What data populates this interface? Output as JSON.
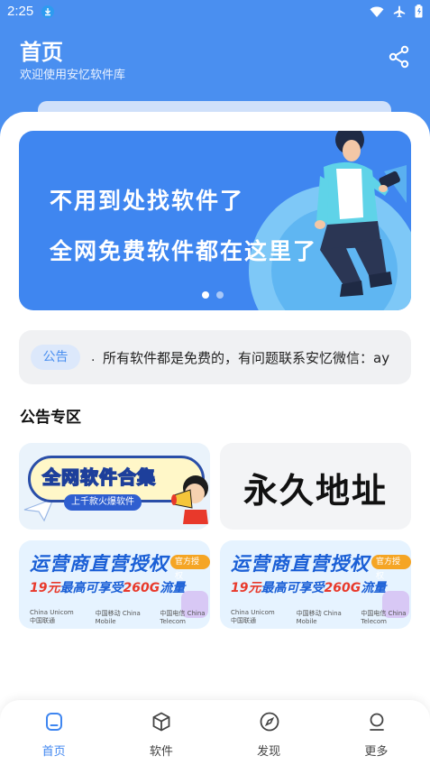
{
  "status_bar": {
    "time": "2:25",
    "icons": [
      "download-icon",
      "wifi-icon",
      "airplane-icon",
      "battery-icon"
    ]
  },
  "header": {
    "title": "首页",
    "subtitle": "欢迎使用安忆软件库",
    "share_icon": "share-icon",
    "background_color": "#4a8ff0"
  },
  "banner": {
    "line1": "不用到处找软件了",
    "line2": "全网免费软件都在这里了",
    "slide_count": 2,
    "active_slide": 1
  },
  "notice": {
    "tag": "公告",
    "bullet": ".",
    "text": "所有软件都是免费的，有问题联系安忆微信：ay"
  },
  "section": {
    "title": "公告专区"
  },
  "tiles": {
    "a": {
      "title": "全网软件合集",
      "subtitle": "上千款火爆软件"
    },
    "b": {
      "title": "永久地址"
    },
    "c": {
      "title": "运营商直营授权",
      "badge": "官方授权",
      "sub_price": "19元",
      "sub_middle": "最高可享受",
      "sub_data": "260G",
      "sub_end": "流量",
      "logos": [
        "China Unicom中国联通",
        "中国移动 China Mobile",
        "中国电信 China Telecom"
      ]
    },
    "d": {
      "title": "运营商直营授权",
      "badge": "官方授权",
      "sub_price": "19元",
      "sub_middle": "最高可享受",
      "sub_data": "260G",
      "sub_end": "流量",
      "logos": [
        "China Unicom中国联通",
        "中国移动 China Mobile",
        "中国电信 China Telecom"
      ]
    }
  },
  "bottom_nav": {
    "items": [
      {
        "label": "首页",
        "icon": "home-icon",
        "active": true
      },
      {
        "label": "软件",
        "icon": "cube-icon",
        "active": false
      },
      {
        "label": "发现",
        "icon": "compass-icon",
        "active": false
      },
      {
        "label": "更多",
        "icon": "person-icon",
        "active": false
      }
    ],
    "active_color": "#3f86f0"
  }
}
